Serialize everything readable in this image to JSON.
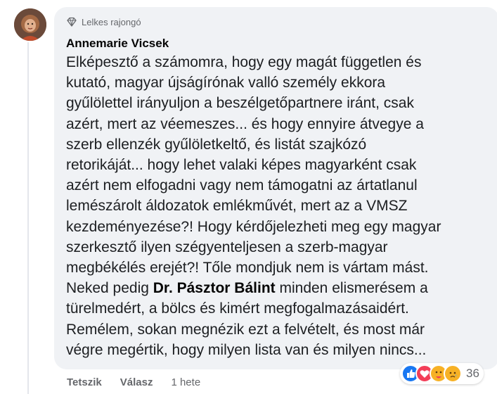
{
  "comment": {
    "badge": "Lelkes rajongó",
    "author": "Annemarie Vicsek",
    "text_before": "Elképesztő a számomra, hogy egy magát független és\nkutató, magyar újságírónak valló személy ekkora\ngyűlölettel irányuljon a beszélgetőpartnere iránt, csak\nazért, mert az véemeszes... és hogy ennyire átvegye a\nszerb ellenzék gyűlöletkeltő, és listát szajkózó\nretorikáját... hogy lehet valaki képes magyarként csak\nazért nem elfogadni vagy nem támogatni az ártatlanul\nlemészárolt áldozatok emlékművét, mert az a VMSZ\nkezdeményezése?! Hogy kérdőjelezheti meg egy magyar\nszerkesztő ilyen szégyenteljesen a szerb-magyar\nmegbékélés erejét?! Tőle mondjuk nem is vártam mást.\nNeked pedig ",
    "mention": "Dr. Pásztor Bálint",
    "text_after": " minden elismerésem a\ntürelmedért, a bölcs és kimért megfogalmazásaidért.\nRemélem, sokan megnézik ezt a felvételt, és most már\nvégre megértik, hogy milyen lista van és milyen nincs..."
  },
  "actions": {
    "like": "Tetszik",
    "reply": "Válasz",
    "time": "1 hete"
  },
  "reactions": {
    "icons": [
      "like-icon",
      "love-icon",
      "care-icon",
      "sad-icon"
    ],
    "count": "36"
  },
  "colors": {
    "bubble": "#f0f2f5",
    "like_blue": "#1877f2",
    "love_red": "#f33e58",
    "emoji_yellow": "#f7b125"
  }
}
